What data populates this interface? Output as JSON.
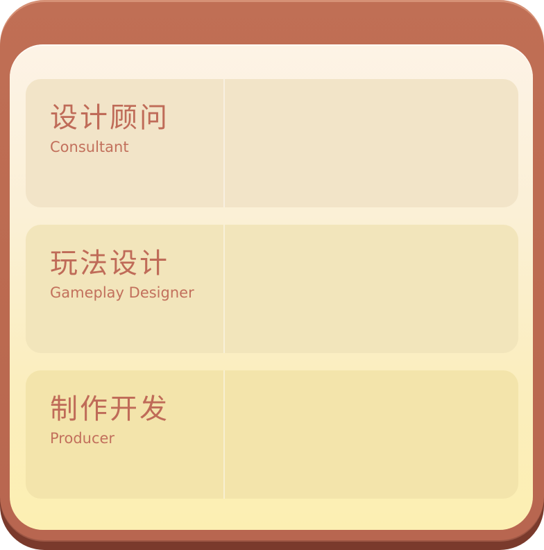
{
  "roles": [
    {
      "cn": "设计顾问",
      "en": "Consultant"
    },
    {
      "cn": "玩法设计",
      "en": "Gameplay Designer"
    },
    {
      "cn": "制作开发",
      "en": "Producer"
    }
  ],
  "colors": {
    "frame": "#bb6a50",
    "frame_shadow": "#7a3a2c",
    "panel_top": "#fdf3e6",
    "panel_bottom": "#fcefb2",
    "text": "#bf6b58"
  }
}
